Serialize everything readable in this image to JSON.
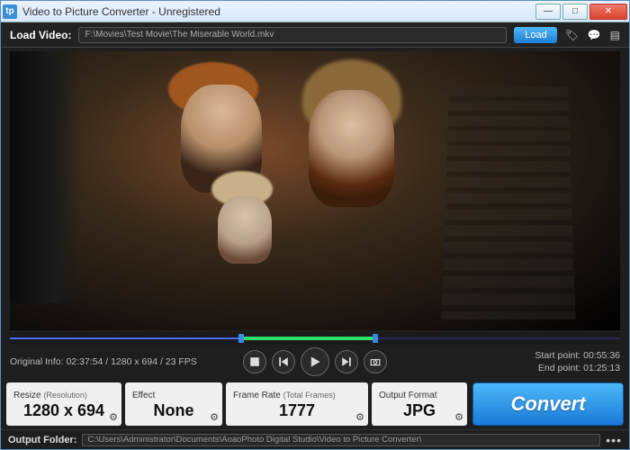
{
  "window": {
    "title": "Video to Picture Converter - Unregistered"
  },
  "load": {
    "label": "Load Video:",
    "path": "F:\\Movies\\Test Movie\\The Miserable World.mkv",
    "button": "Load"
  },
  "timeline": {
    "progress_pct": 38,
    "selection_start_pct": 38,
    "selection_end_pct": 60
  },
  "info": {
    "original_label": "Original Info:",
    "original_value": "02:37:54 / 1280 x 694 / 23 FPS",
    "start_label": "Start point:",
    "start_value": "00:55:36",
    "end_label": "End point:",
    "end_value": "01:25:13"
  },
  "params": {
    "resize": {
      "label": "Resize",
      "sublabel": "(Resolution)",
      "value": "1280 x 694"
    },
    "effect": {
      "label": "Effect",
      "value": "None"
    },
    "framerate": {
      "label": "Frame Rate",
      "sublabel": "(Total Frames)",
      "value": "1777"
    },
    "output_format": {
      "label": "Output Format",
      "value": "JPG"
    }
  },
  "convert": {
    "label": "Convert"
  },
  "output": {
    "label": "Output Folder:",
    "path": "C:\\Users\\Administrator\\Documents\\AoaoPhoto Digital Studio\\Video to Picture Converter\\"
  }
}
